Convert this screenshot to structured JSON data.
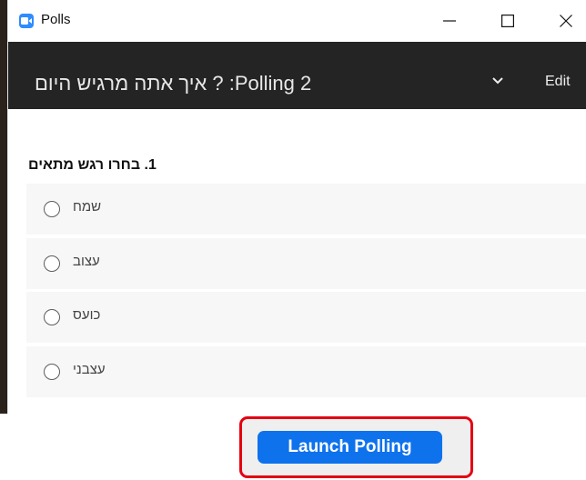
{
  "window": {
    "title": "Polls",
    "controls": [
      "minimize",
      "maximize",
      "close"
    ]
  },
  "header": {
    "poll_title": "Polling 2: ? איך אתה מרגיש היום",
    "chevron_icon": "chevron-down-icon",
    "edit_label": "Edit"
  },
  "poll": {
    "question": "1. בחרו רגש מתאים",
    "options": [
      {
        "label": "שמח"
      },
      {
        "label": "עצוב"
      },
      {
        "label": "כועס"
      },
      {
        "label": "עצבני"
      }
    ]
  },
  "footer": {
    "launch_label": "Launch Polling",
    "highlight_color": "#e30012",
    "button_color": "#0e72ed"
  }
}
